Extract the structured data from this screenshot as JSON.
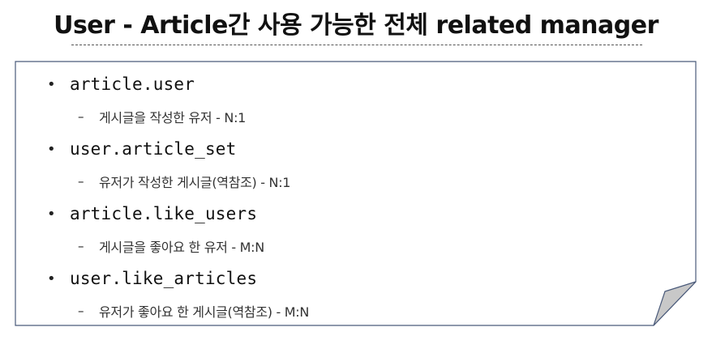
{
  "title": "User - Article간 사용 가능한 전체 related manager",
  "items": [
    {
      "bullet": "•",
      "code": "article.user",
      "dash": "–",
      "desc": "게시글을 작성한 유저 - N:1"
    },
    {
      "bullet": "•",
      "code": "user.article_set",
      "dash": "–",
      "desc": "유저가 작성한 게시글(역참조) - N:1"
    },
    {
      "bullet": "•",
      "code": "article.like_users",
      "dash": "–",
      "desc": "게시글을 좋아요 한 유저 - M:N"
    },
    {
      "bullet": "•",
      "code": "user.like_articles",
      "dash": "–",
      "desc": "유저가 좋아요 한 게시글(역참조) - M:N"
    }
  ],
  "colors": {
    "card_border": "#4a5a7a",
    "card_fold_fill": "#c8c8c8",
    "title_text": "#111111"
  }
}
